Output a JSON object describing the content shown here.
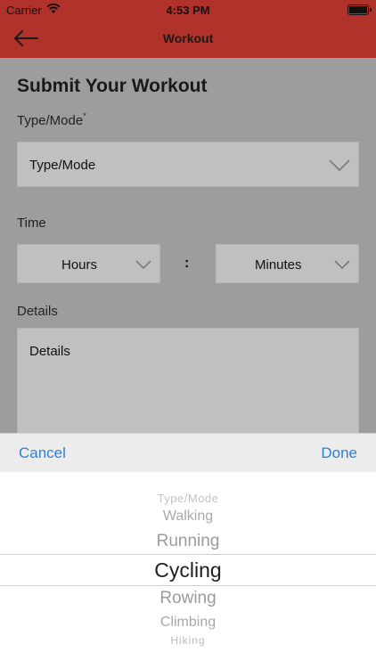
{
  "status_bar": {
    "carrier": "Carrier",
    "time": "4:53 PM"
  },
  "nav": {
    "title": "Workout"
  },
  "form": {
    "title": "Submit Your Workout",
    "type_label": "Type/Mode",
    "type_required_mark": "*",
    "type_placeholder": "Type/Mode",
    "time_label": "Time",
    "hours_placeholder": "Hours",
    "separator": ":",
    "minutes_placeholder": "Minutes",
    "details_label": "Details",
    "details_placeholder": "Details"
  },
  "toolbar": {
    "cancel_label": "Cancel",
    "done_label": "Done"
  },
  "picker": {
    "items": [
      "Type/Mode",
      "Walking",
      "Running",
      "Cycling",
      "Rowing",
      "Climbing",
      "Hiking"
    ],
    "selected": "Cycling"
  },
  "colors": {
    "nav_bar": "#b0322a",
    "toolbar_button": "#2f7fd3",
    "dim_overlay": "#9d9d9d"
  }
}
